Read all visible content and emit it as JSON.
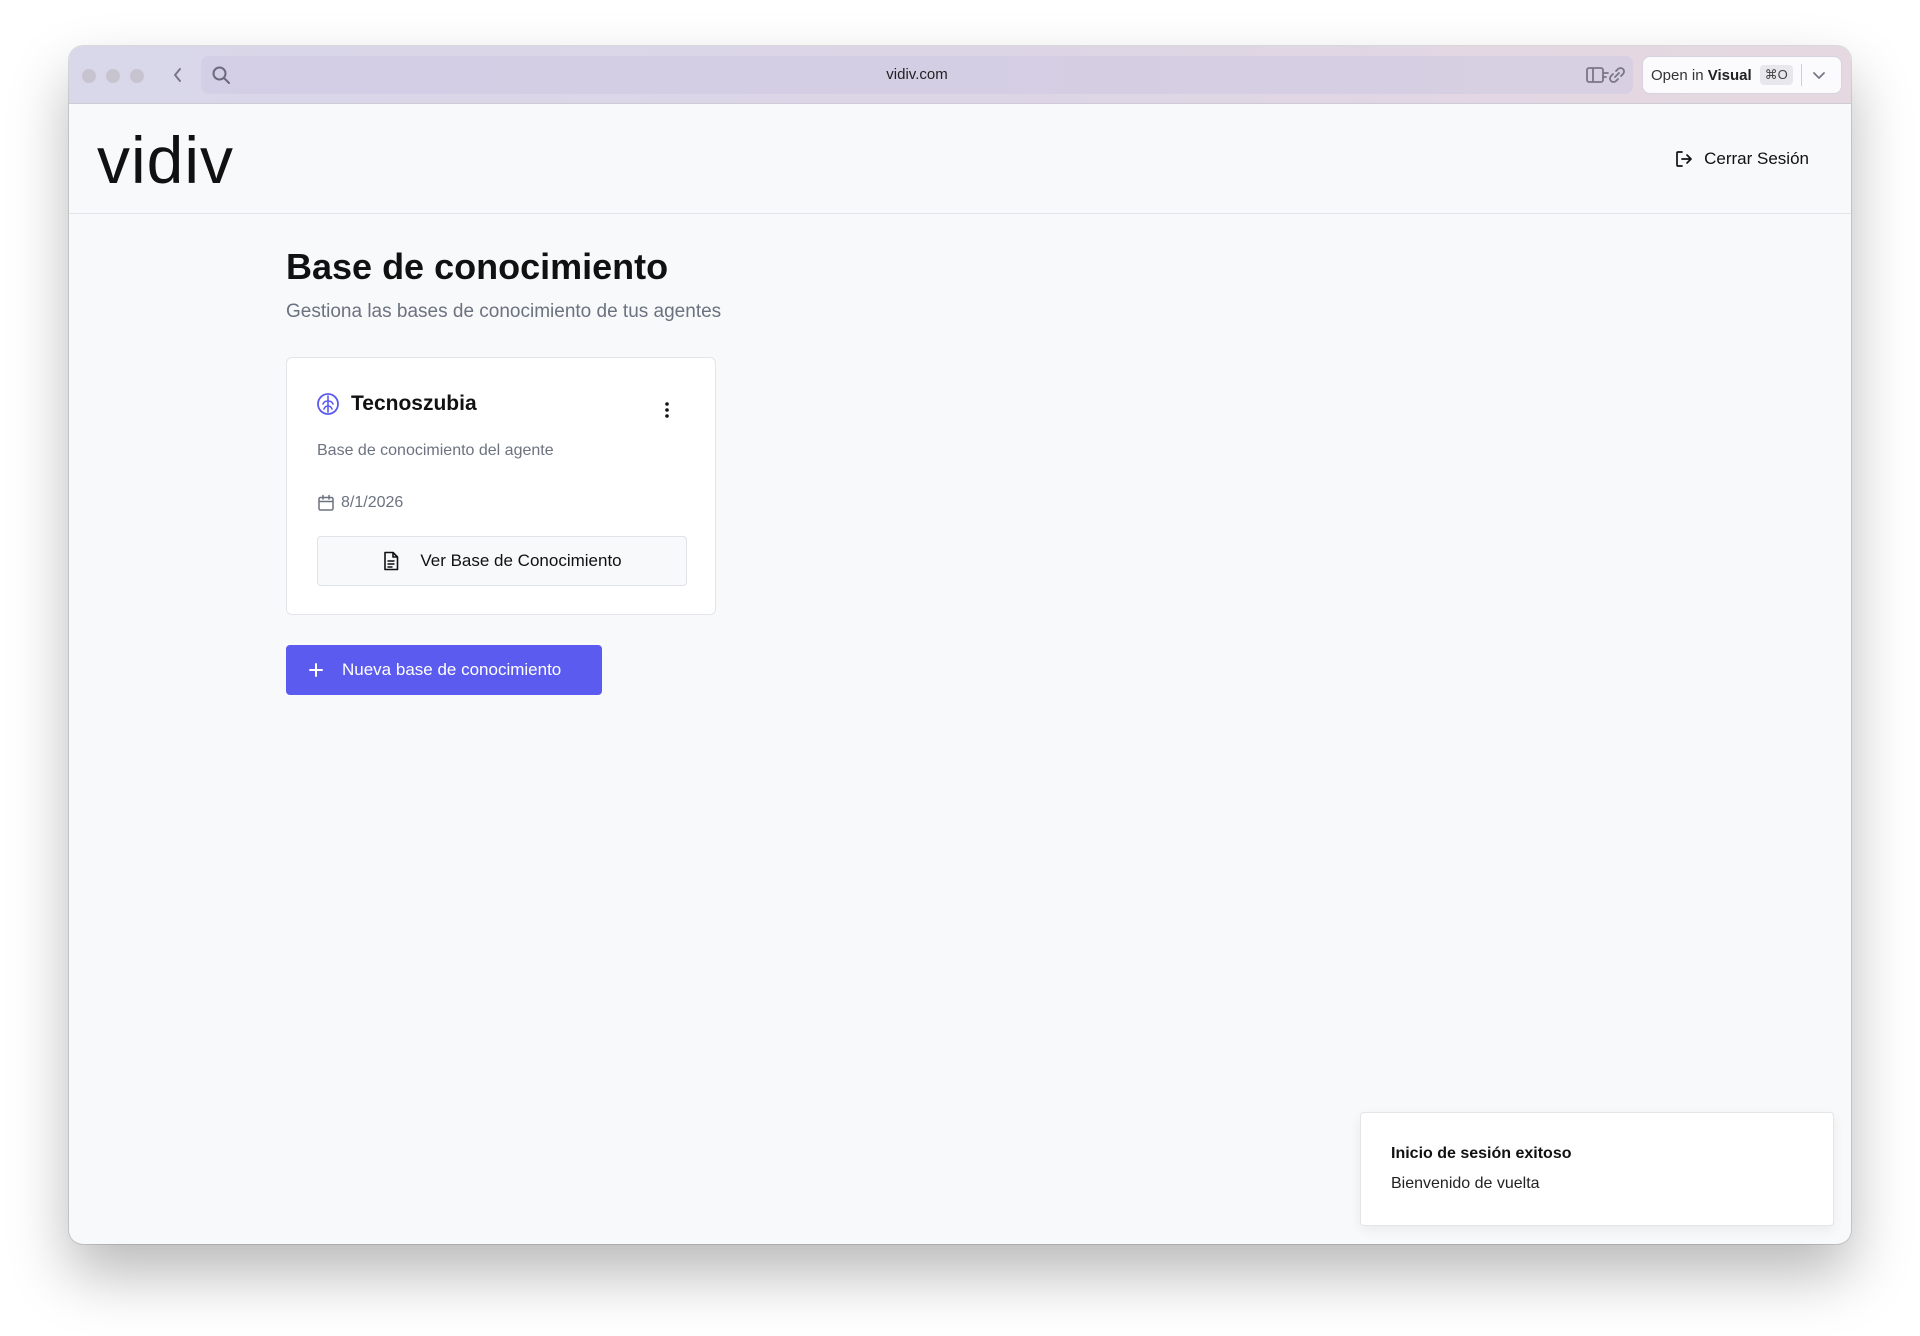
{
  "browser": {
    "url": "vidiv.com",
    "open_in_label": "Open in ",
    "open_in_app": "Visual",
    "shortcut": "⌘O"
  },
  "header": {
    "logo": "vidiv",
    "logout_label": "Cerrar Sesión"
  },
  "main": {
    "title": "Base de conocimiento",
    "subtitle": "Gestiona las bases de conocimiento de tus agentes",
    "knowledge_bases": [
      {
        "name": "Tecnoszubia",
        "description": "Base de conocimiento del agente",
        "date": "8/1/2026",
        "view_label": "Ver Base de Conocimiento"
      }
    ],
    "new_button_label": "Nueva base de conocimiento"
  },
  "toast": {
    "title": "Inicio de sesión exitoso",
    "description": "Bienvenido de vuelta"
  },
  "colors": {
    "accent": "#5b5bf0",
    "background": "#f8f9fa",
    "muted_text": "#6b7280"
  }
}
